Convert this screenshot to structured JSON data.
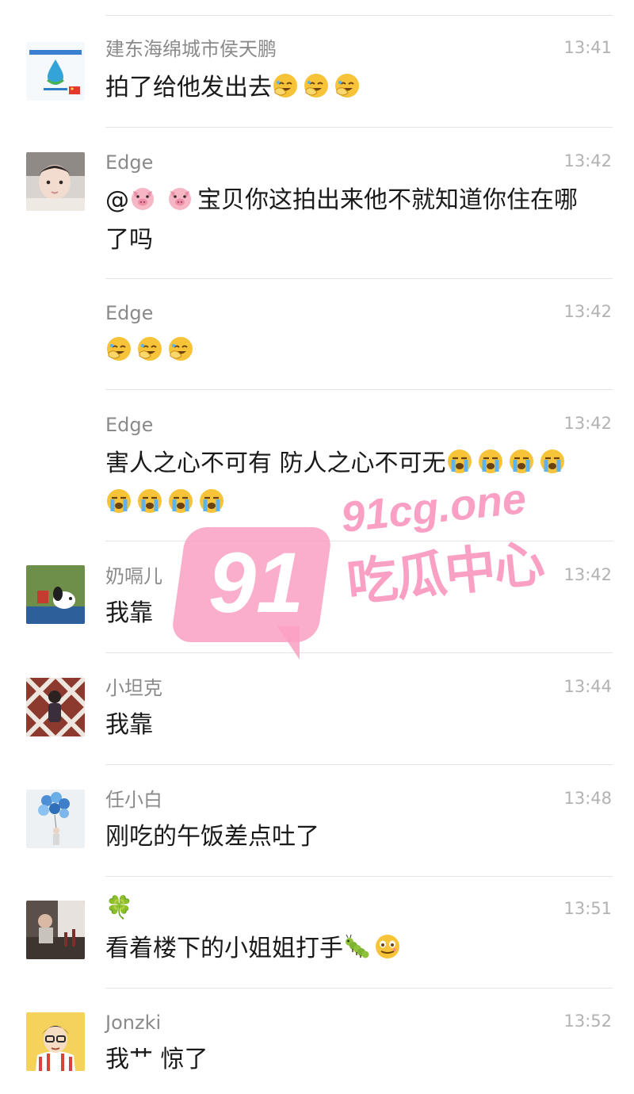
{
  "messages": [
    {
      "sender": "建东海绵城市侯天鹏",
      "time": "13:41",
      "text": "拍了给他发出去",
      "emoji_after": [
        "face-palm-laugh",
        "face-palm-laugh",
        "face-palm-laugh"
      ],
      "avatar": "water-drop-logo-avatar"
    },
    {
      "sender": "Edge",
      "time": "13:42",
      "text_parts": [
        "@",
        "pig",
        " ",
        "pig",
        " 宝贝你这拍出来他不就知道你住在哪了吗"
      ],
      "mention": "@",
      "text": "宝贝你这拍出来他不就知道你住在哪了吗",
      "avatar": "baby-photo-avatar"
    },
    {
      "sender": "Edge",
      "time": "13:42",
      "text": "",
      "emoji_after": [
        "face-palm-laugh",
        "face-palm-laugh",
        "face-palm-laugh"
      ]
    },
    {
      "sender": "Edge",
      "time": "13:42",
      "text": "害人之心不可有 防人之心不可无",
      "emoji_after": [
        "loudly-crying",
        "loudly-crying",
        "loudly-crying",
        "loudly-crying",
        "loudly-crying",
        "loudly-crying",
        "loudly-crying",
        "loudly-crying"
      ]
    },
    {
      "sender": "奶嗝儿",
      "time": "13:42",
      "text": "我靠",
      "avatar": "snoopy-avatar"
    },
    {
      "sender": "小坦克",
      "time": "13:44",
      "text": "我靠",
      "avatar": "checkered-person-avatar"
    },
    {
      "sender": "任小白",
      "time": "13:48",
      "text": "刚吃的午饭差点吐了",
      "avatar": "balloons-avatar"
    },
    {
      "sender": "🍀",
      "time": "13:51",
      "text": "看着楼下的小姐姐打手",
      "emoji_after": [
        "caterpillar",
        "zipper-mouth-face"
      ],
      "avatar": "room-photo-avatar"
    },
    {
      "sender": "Jonzki",
      "time": "13:52",
      "text": "我艹 惊了",
      "avatar": "cartoon-glasses-avatar"
    }
  ],
  "watermark": {
    "number": "91",
    "domain": "91cg.one",
    "name": "吃瓜中心"
  },
  "colors": {
    "sender": "#8a8a8a",
    "time": "#b2b2b2",
    "text": "#1a1a1a",
    "separator": "#e4e4e4",
    "watermark": "#f8a0c4"
  }
}
